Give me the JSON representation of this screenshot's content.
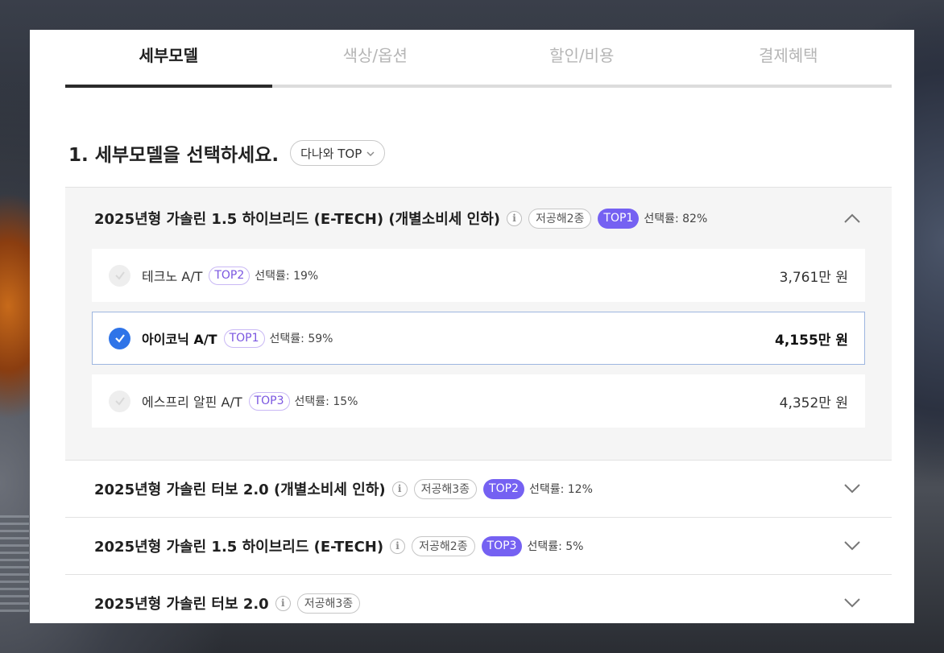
{
  "tabs": [
    {
      "label": "세부모델",
      "active": true
    },
    {
      "label": "색상/옵션",
      "active": false
    },
    {
      "label": "할인/비용",
      "active": false
    },
    {
      "label": "결제혜택",
      "active": false
    }
  ],
  "section": {
    "title": "1. 세부모델을 선택하세요.",
    "filter_label": "다나와 TOP"
  },
  "groups": [
    {
      "title": "2025년형 가솔린 1.5 하이브리드 (E-TECH) (개별소비세 인하)",
      "emission_badge": "저공해2종",
      "top_badge": "TOP1",
      "rate": "선택률: 82%",
      "open": true,
      "options": [
        {
          "name": "테크노 A/T",
          "top": "TOP2",
          "rate": "선택률: 19%",
          "price": "3,761만 원",
          "selected": false
        },
        {
          "name": "아이코닉 A/T",
          "top": "TOP1",
          "rate": "선택률: 59%",
          "price": "4,155만 원",
          "selected": true
        },
        {
          "name": "에스프리 알핀 A/T",
          "top": "TOP3",
          "rate": "선택률: 15%",
          "price": "4,352만 원",
          "selected": false
        }
      ]
    },
    {
      "title": "2025년형 가솔린 터보 2.0 (개별소비세 인하)",
      "emission_badge": "저공해3종",
      "top_badge": "TOP2",
      "rate": "선택률: 12%",
      "open": false
    },
    {
      "title": "2025년형 가솔린 1.5 하이브리드 (E-TECH)",
      "emission_badge": "저공해2종",
      "top_badge": "TOP3",
      "rate": "선택률: 5%",
      "open": false
    },
    {
      "title": "2025년형 가솔린 터보 2.0",
      "emission_badge": "저공해3종",
      "open": false
    }
  ],
  "colors": {
    "accent_purple": "#7561f2",
    "check_blue": "#2f74e8"
  }
}
